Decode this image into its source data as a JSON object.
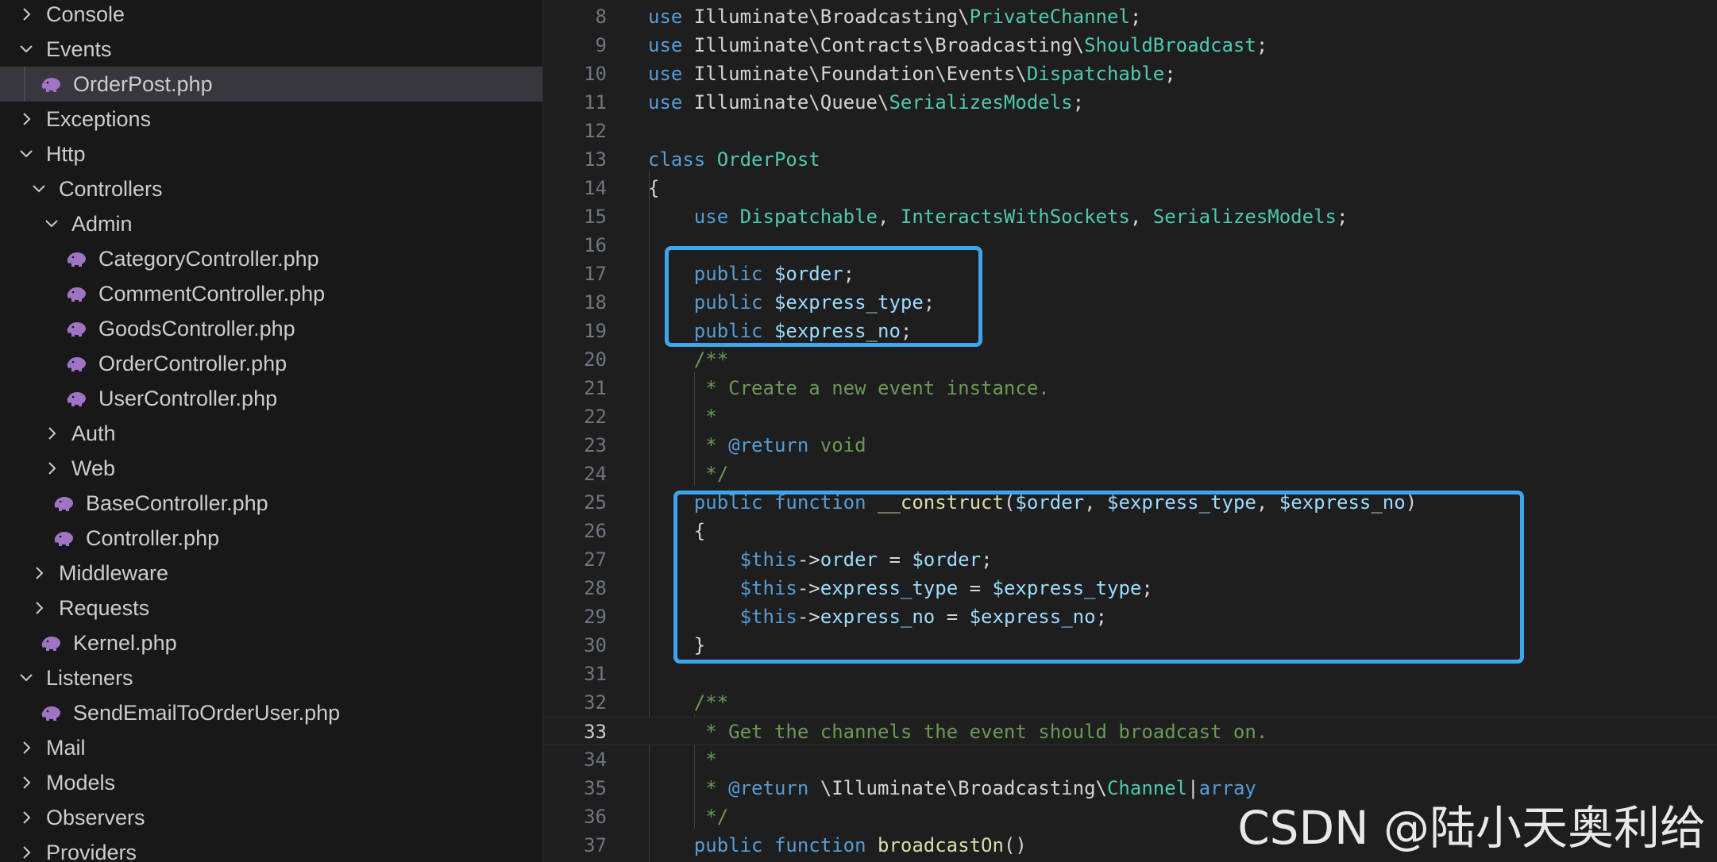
{
  "sidebar": {
    "items": [
      {
        "label": "Console",
        "type": "folder",
        "expanded": false,
        "depth": 0
      },
      {
        "label": "Events",
        "type": "folder",
        "expanded": true,
        "depth": 0
      },
      {
        "label": "OrderPost.php",
        "type": "php",
        "depth": 1,
        "selected": true
      },
      {
        "label": "Exceptions",
        "type": "folder",
        "expanded": false,
        "depth": 0
      },
      {
        "label": "Http",
        "type": "folder",
        "expanded": true,
        "depth": 0
      },
      {
        "label": "Controllers",
        "type": "folder",
        "expanded": true,
        "depth": 1
      },
      {
        "label": "Admin",
        "type": "folder",
        "expanded": true,
        "depth": 2
      },
      {
        "label": "CategoryController.php",
        "type": "php",
        "depth": 3
      },
      {
        "label": "CommentController.php",
        "type": "php",
        "depth": 3
      },
      {
        "label": "GoodsController.php",
        "type": "php",
        "depth": 3
      },
      {
        "label": "OrderController.php",
        "type": "php",
        "depth": 3
      },
      {
        "label": "UserController.php",
        "type": "php",
        "depth": 3
      },
      {
        "label": "Auth",
        "type": "folder",
        "expanded": false,
        "depth": 2
      },
      {
        "label": "Web",
        "type": "folder",
        "expanded": false,
        "depth": 2
      },
      {
        "label": "BaseController.php",
        "type": "php",
        "depth": 2
      },
      {
        "label": "Controller.php",
        "type": "php",
        "depth": 2
      },
      {
        "label": "Middleware",
        "type": "folder",
        "expanded": false,
        "depth": 1
      },
      {
        "label": "Requests",
        "type": "folder",
        "expanded": false,
        "depth": 1
      },
      {
        "label": "Kernel.php",
        "type": "php",
        "depth": 1
      },
      {
        "label": "Listeners",
        "type": "folder",
        "expanded": true,
        "depth": 0
      },
      {
        "label": "SendEmailToOrderUser.php",
        "type": "php",
        "depth": 1
      },
      {
        "label": "Mail",
        "type": "folder",
        "expanded": false,
        "depth": 0
      },
      {
        "label": "Models",
        "type": "folder",
        "expanded": false,
        "depth": 0
      },
      {
        "label": "Observers",
        "type": "folder",
        "expanded": false,
        "depth": 0
      },
      {
        "label": "Providers",
        "type": "folder",
        "expanded": false,
        "depth": 0
      }
    ]
  },
  "editor": {
    "active_line": "33",
    "lines": [
      {
        "n": "8",
        "tokens": [
          [
            "kw",
            "use "
          ],
          [
            "tx",
            "Illuminate\\Broadcasting\\"
          ],
          [
            "cls",
            "PrivateChannel"
          ],
          [
            "tx",
            ";"
          ]
        ]
      },
      {
        "n": "9",
        "tokens": [
          [
            "kw",
            "use "
          ],
          [
            "tx",
            "Illuminate\\Contracts\\Broadcasting\\"
          ],
          [
            "cls",
            "ShouldBroadcast"
          ],
          [
            "tx",
            ";"
          ]
        ]
      },
      {
        "n": "10",
        "tokens": [
          [
            "kw",
            "use "
          ],
          [
            "tx",
            "Illuminate\\Foundation\\Events\\"
          ],
          [
            "cls",
            "Dispatchable"
          ],
          [
            "tx",
            ";"
          ]
        ]
      },
      {
        "n": "11",
        "tokens": [
          [
            "kw",
            "use "
          ],
          [
            "tx",
            "Illuminate\\Queue\\"
          ],
          [
            "cls",
            "SerializesModels"
          ],
          [
            "tx",
            ";"
          ]
        ]
      },
      {
        "n": "12",
        "tokens": []
      },
      {
        "n": "13",
        "tokens": [
          [
            "kw",
            "class "
          ],
          [
            "cls",
            "OrderPost"
          ]
        ]
      },
      {
        "n": "14",
        "tokens": [
          [
            "tx",
            "{"
          ]
        ]
      },
      {
        "n": "15",
        "tokens": [
          [
            "tx",
            "    "
          ],
          [
            "kw",
            "use "
          ],
          [
            "cls",
            "Dispatchable"
          ],
          [
            "tx",
            ", "
          ],
          [
            "cls",
            "InteractsWithSockets"
          ],
          [
            "tx",
            ", "
          ],
          [
            "cls",
            "SerializesModels"
          ],
          [
            "tx",
            ";"
          ]
        ]
      },
      {
        "n": "16",
        "tokens": []
      },
      {
        "n": "17",
        "tokens": [
          [
            "tx",
            "    "
          ],
          [
            "kw",
            "public "
          ],
          [
            "var",
            "$order"
          ],
          [
            "tx",
            ";"
          ]
        ]
      },
      {
        "n": "18",
        "tokens": [
          [
            "tx",
            "    "
          ],
          [
            "kw",
            "public "
          ],
          [
            "var",
            "$express_type"
          ],
          [
            "tx",
            ";"
          ]
        ]
      },
      {
        "n": "19",
        "tokens": [
          [
            "tx",
            "    "
          ],
          [
            "kw",
            "public "
          ],
          [
            "var",
            "$express_no"
          ],
          [
            "tx",
            ";"
          ]
        ]
      },
      {
        "n": "20",
        "tokens": [
          [
            "tx",
            "    "
          ],
          [
            "cm",
            "/**"
          ]
        ]
      },
      {
        "n": "21",
        "tokens": [
          [
            "tx",
            "     "
          ],
          [
            "cm",
            "* Create a new event instance."
          ]
        ]
      },
      {
        "n": "22",
        "tokens": [
          [
            "tx",
            "     "
          ],
          [
            "cm",
            "*"
          ]
        ]
      },
      {
        "n": "23",
        "tokens": [
          [
            "tx",
            "     "
          ],
          [
            "cm",
            "* "
          ],
          [
            "kw",
            "@return "
          ],
          [
            "cm",
            "void"
          ]
        ]
      },
      {
        "n": "24",
        "tokens": [
          [
            "tx",
            "     "
          ],
          [
            "cm",
            "*/"
          ]
        ]
      },
      {
        "n": "25",
        "tokens": [
          [
            "tx",
            "    "
          ],
          [
            "kw",
            "public function "
          ],
          [
            "fn",
            "__construct"
          ],
          [
            "tx",
            "("
          ],
          [
            "var",
            "$order"
          ],
          [
            "tx",
            ", "
          ],
          [
            "var",
            "$express_type"
          ],
          [
            "tx",
            ", "
          ],
          [
            "var",
            "$express_no"
          ],
          [
            "tx",
            ")"
          ]
        ]
      },
      {
        "n": "26",
        "tokens": [
          [
            "tx",
            "    {"
          ]
        ]
      },
      {
        "n": "27",
        "tokens": [
          [
            "tx",
            "        "
          ],
          [
            "kw",
            "$this"
          ],
          [
            "tx",
            "->"
          ],
          [
            "var",
            "order"
          ],
          [
            "tx",
            " = "
          ],
          [
            "var",
            "$order"
          ],
          [
            "tx",
            ";"
          ]
        ]
      },
      {
        "n": "28",
        "tokens": [
          [
            "tx",
            "        "
          ],
          [
            "kw",
            "$this"
          ],
          [
            "tx",
            "->"
          ],
          [
            "var",
            "express_type"
          ],
          [
            "tx",
            " = "
          ],
          [
            "var",
            "$express_type"
          ],
          [
            "tx",
            ";"
          ]
        ]
      },
      {
        "n": "29",
        "tokens": [
          [
            "tx",
            "        "
          ],
          [
            "kw",
            "$this"
          ],
          [
            "tx",
            "->"
          ],
          [
            "var",
            "express_no"
          ],
          [
            "tx",
            " = "
          ],
          [
            "var",
            "$express_no"
          ],
          [
            "tx",
            ";"
          ]
        ]
      },
      {
        "n": "30",
        "tokens": [
          [
            "tx",
            "    }"
          ]
        ]
      },
      {
        "n": "31",
        "tokens": []
      },
      {
        "n": "32",
        "tokens": [
          [
            "tx",
            "    "
          ],
          [
            "cm",
            "/**"
          ]
        ]
      },
      {
        "n": "33",
        "tokens": [
          [
            "tx",
            "     "
          ],
          [
            "cm",
            "* Get the channels the event should broadcast on."
          ]
        ]
      },
      {
        "n": "34",
        "tokens": [
          [
            "tx",
            "     "
          ],
          [
            "cm",
            "*"
          ]
        ]
      },
      {
        "n": "35",
        "tokens": [
          [
            "tx",
            "     "
          ],
          [
            "cm",
            "* "
          ],
          [
            "kw",
            "@return "
          ],
          [
            "tx",
            "\\Illuminate\\Broadcasting\\"
          ],
          [
            "cls",
            "Channel"
          ],
          [
            "tx",
            "|"
          ],
          [
            "kw",
            "array"
          ]
        ]
      },
      {
        "n": "36",
        "tokens": [
          [
            "tx",
            "     "
          ],
          [
            "cm",
            "*/"
          ]
        ]
      },
      {
        "n": "37",
        "tokens": [
          [
            "tx",
            "    "
          ],
          [
            "kw",
            "public function "
          ],
          [
            "fn",
            "broadcastOn"
          ],
          [
            "tx",
            "()"
          ]
        ]
      }
    ]
  },
  "watermark": "CSDN @陆小天奥利给",
  "colors": {
    "highlight_box": "#3da6ef",
    "php_icon": "#a074c4"
  }
}
